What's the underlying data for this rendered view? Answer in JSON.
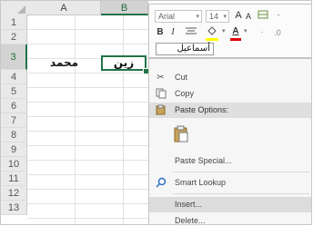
{
  "columns": [
    "A",
    "B"
  ],
  "rows": [
    "1",
    "2",
    "3",
    "4",
    "5",
    "6",
    "7",
    "8",
    "9",
    "10",
    "11",
    "12",
    "13"
  ],
  "cells": {
    "A3": "محمد",
    "B3": "زين"
  },
  "mini_toolbar": {
    "font_name": "Arial",
    "font_size": "14",
    "grow_font": "A",
    "shrink_font": "A",
    "bold": "B",
    "italic": "I",
    "font_color_letter": "A",
    "fill_color": "#ffff00",
    "font_color": "#e00000",
    "cell_input_value": "أسماعيل"
  },
  "context_menu": {
    "items": [
      {
        "label": "Cut",
        "icon": "scissors-icon"
      },
      {
        "label": "Copy",
        "icon": "copy-icon"
      },
      {
        "label": "Paste Options:",
        "icon": "paste-icon"
      },
      {
        "label": "Paste Special...",
        "icon": ""
      },
      {
        "label": "Smart Lookup",
        "icon": "search-icon"
      },
      {
        "label": "Insert...",
        "icon": ""
      },
      {
        "label": "Delete...",
        "icon": ""
      }
    ]
  }
}
